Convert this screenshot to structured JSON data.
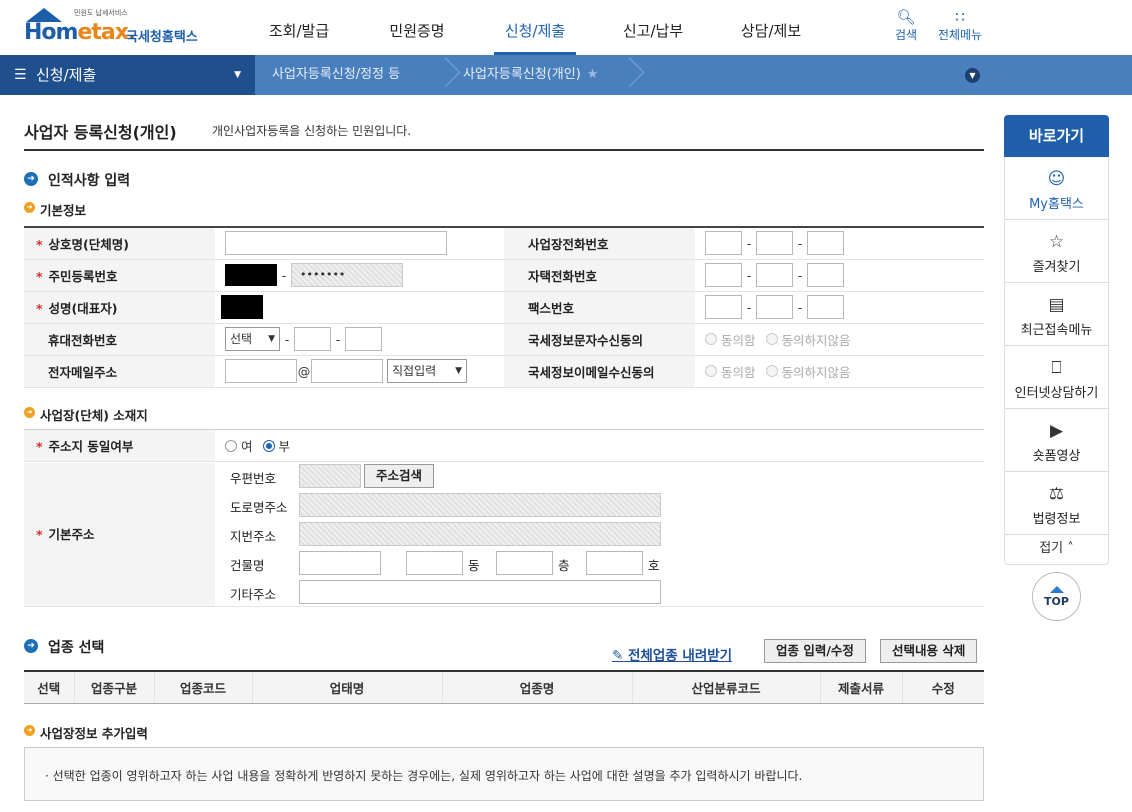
{
  "header": {
    "logo_small": "민원도 납세서비스",
    "logo_home": "Hom",
    "logo_etax": "etax.",
    "logo_kor": "국세청홈택스",
    "menu": [
      "조회/발급",
      "민원증명",
      "신청/제출",
      "신고/납부",
      "상담/제보"
    ],
    "search_label": "검색",
    "allmenu_label": "전체메뉴"
  },
  "breadcrumb": {
    "section": "신청/제출",
    "level2": "사업자등록신청/정정 등",
    "level3": "사업자등록신청(개인)"
  },
  "page": {
    "title": "사업자 등록신청(개인)",
    "desc": "개인사업자등록을 신청하는 민원입니다."
  },
  "personal": {
    "section_title": "인적사항 입력",
    "basic_title": "기본정보",
    "labels": {
      "company": "상호명(단체명)",
      "rrn": "주민등록번호",
      "name": "성명(대표자)",
      "mobile": "휴대전화번호",
      "email": "전자메일주소",
      "biz_phone": "사업장전화번호",
      "home_phone": "자택전화번호",
      "fax": "팩스번호",
      "sms_agree": "국세정보문자수신동의",
      "email_agree": "국세정보이메일수신동의"
    },
    "rrn_masked": "•••••••",
    "mobile_select": "선택",
    "email_at": "@",
    "email_select": "직접입력",
    "agree": "동의함",
    "disagree": "동의하지않음"
  },
  "location": {
    "section_title": "사업장(단체) 소재지",
    "same_label": "주소지 동일여부",
    "yes": "여",
    "no": "부",
    "basic_addr_label": "기본주소",
    "zip": "우편번호",
    "search_btn": "주소검색",
    "road": "도로명주소",
    "jibun": "지번주소",
    "building": "건물명",
    "dong": "동",
    "floor": "층",
    "ho": "호",
    "etc": "기타주소"
  },
  "industry": {
    "section_title": "업종 선택",
    "download_link": "전체업종 내려받기",
    "input_btn": "업종 입력/수정",
    "delete_btn": "선택내용 삭제",
    "columns": [
      "선택",
      "업종구분",
      "업종코드",
      "업태명",
      "업종명",
      "산업분류코드",
      "제출서류",
      "수정"
    ]
  },
  "extra": {
    "title": "사업장정보 추가입력",
    "note": "선택한 업종이 영위하고자 하는 사업 내용을 정확하게 반영하지 못하는 경우에는, 실제 영위하고자 하는 사업에 대한 설명을 추가 입력하시기 바랍니다."
  },
  "sidebar": {
    "title": "바로가기",
    "items": [
      "My홈택스",
      "즐겨찾기",
      "최근접속메뉴",
      "인터넷상담하기",
      "숏폼영상",
      "법령정보"
    ],
    "fold": "접기",
    "top": "TOP"
  }
}
